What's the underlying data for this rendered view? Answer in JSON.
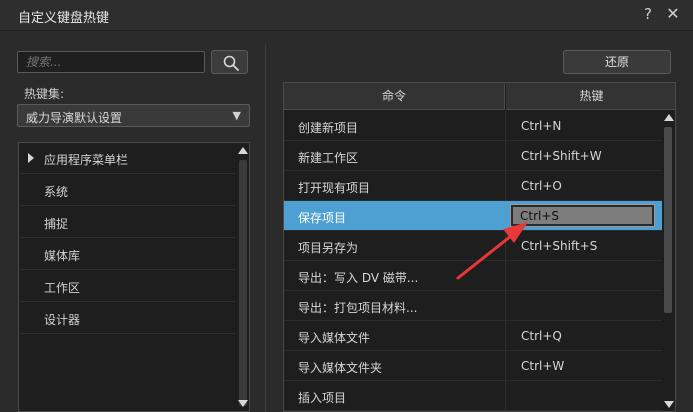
{
  "window": {
    "title": "自定义键盘热键",
    "help_glyph": "?",
    "close_glyph": "✕"
  },
  "search": {
    "placeholder": "搜索..."
  },
  "hotkey_set": {
    "label": "热键集:",
    "selected": "威力导演默认设置"
  },
  "categories": [
    {
      "label": "应用程序菜单栏",
      "expandable": true
    },
    {
      "label": "系统"
    },
    {
      "label": "捕捉"
    },
    {
      "label": "媒体库"
    },
    {
      "label": "工作区"
    },
    {
      "label": "设计器"
    }
  ],
  "toolbar": {
    "restore_label": "还原"
  },
  "table": {
    "columns": [
      "命令",
      "热键"
    ],
    "rows": [
      {
        "command": "创建新项目",
        "hotkey": "Ctrl+N"
      },
      {
        "command": "新建工作区",
        "hotkey": "Ctrl+Shift+W"
      },
      {
        "command": "打开现有项目",
        "hotkey": "Ctrl+O"
      },
      {
        "command": "保存项目",
        "hotkey": "Ctrl+S",
        "selected": true
      },
      {
        "command": "项目另存为",
        "hotkey": "Ctrl+Shift+S"
      },
      {
        "command": "导出：写入 DV 磁带...",
        "hotkey": ""
      },
      {
        "command": "导出：打包项目材料...",
        "hotkey": ""
      },
      {
        "command": "导入媒体文件",
        "hotkey": "Ctrl+Q"
      },
      {
        "command": "导入媒体文件夹",
        "hotkey": "Ctrl+W"
      },
      {
        "command": "插入项目",
        "hotkey": ""
      }
    ]
  },
  "colors": {
    "selection": "#4fa0d2",
    "annotation_arrow": "#e8383a"
  },
  "icons": {
    "search": "magnifier",
    "dropdown": "triangle-down",
    "expand": "triangle-right"
  }
}
